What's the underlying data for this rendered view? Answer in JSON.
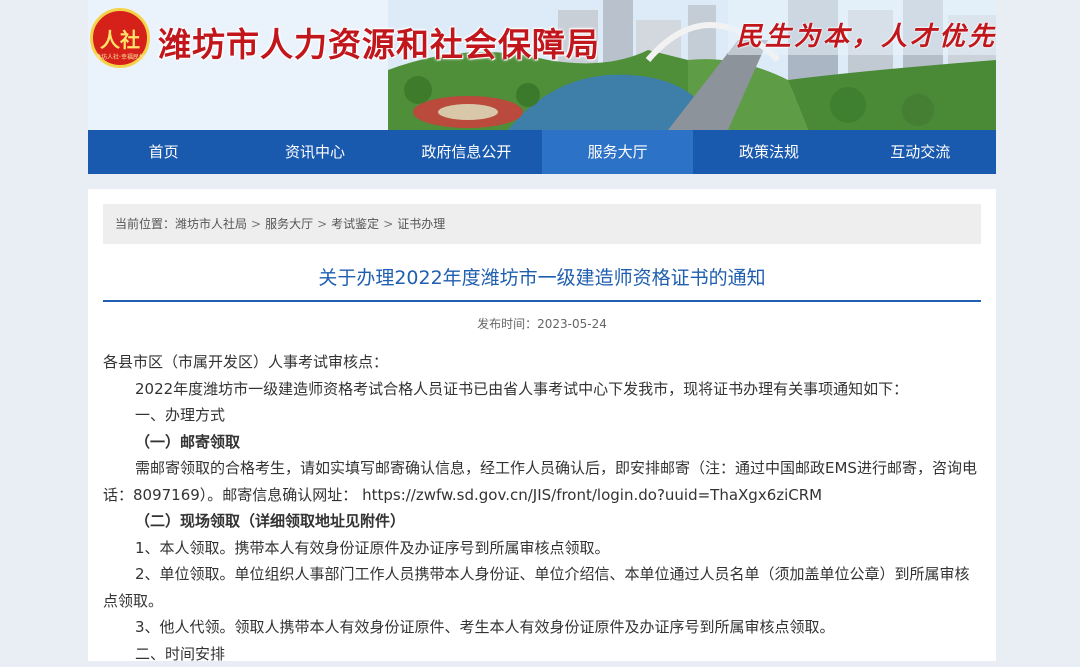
{
  "header": {
    "logo_text": "人社",
    "logo_subtext": "潍坊人社·幸福民生",
    "site_title": "潍坊市人力资源和社会保障局",
    "slogan": "民生为本，人才优先"
  },
  "nav": {
    "items": [
      {
        "label": "首页"
      },
      {
        "label": "资讯中心"
      },
      {
        "label": "政府信息公开"
      },
      {
        "label": "服务大厅"
      },
      {
        "label": "政策法规"
      },
      {
        "label": "互动交流"
      }
    ],
    "active_index": 3
  },
  "breadcrumb": {
    "prefix": "当前位置：",
    "items": [
      "潍坊市人社局",
      "服务大厅",
      "考试鉴定",
      "证书办理"
    ],
    "separator": ">"
  },
  "article": {
    "title": "关于办理2022年度潍坊市一级建造师资格证书的通知",
    "date_label": "发布时间：",
    "date": "2023-05-24",
    "p1": "各县市区（市属开发区）人事考试审核点：",
    "p2": "2022年度潍坊市一级建造师资格考试合格人员证书已由省人事考试中心下发我市，现将证书办理有关事项通知如下：",
    "p3": "一、办理方式",
    "p4": "（一）邮寄领取",
    "p5_text": "需邮寄领取的合格考生，请如实填写邮寄确认信息，经工作人员确认后，即安排邮寄（注：通过中国邮政EMS进行邮寄，咨询电话：8097169）。邮寄信息确认网址：",
    "p5_url": "https://zwfw.sd.gov.cn/JIS/front/login.do?uuid=ThaXgx6ziCRM",
    "p6": "（二）现场领取（详细领取地址见附件）",
    "p7": "1、本人领取。携带本人有效身份证原件及办证序号到所属审核点领取。",
    "p8": "2、单位领取。单位组织人事部门工作人员携带本人身份证、单位介绍信、本单位通过人员名单（须加盖单位公章）到所属审核点领取。",
    "p9": "3、他人代领。领取人携带本人有效身份证原件、考生本人有效身份证原件及办证序号到所属审核点领取。",
    "p10": "二、时间安排"
  },
  "colors": {
    "nav_bg": "#1a5aae",
    "nav_active": "#2c72c6",
    "title_blue": "#1f5fb0",
    "brand_red": "#c0161c"
  }
}
